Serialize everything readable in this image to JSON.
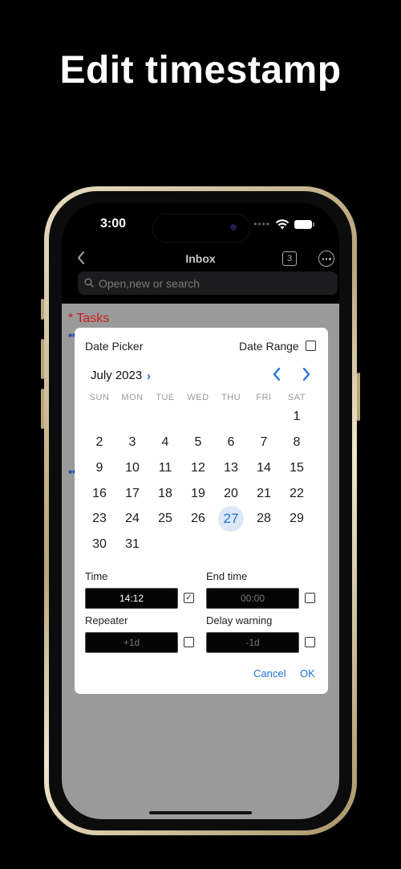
{
  "headline": "Edit timestamp",
  "status": {
    "time": "3:00"
  },
  "nav": {
    "title": "Inbox",
    "count": "3"
  },
  "search": {
    "placeholder": "Open,new or search"
  },
  "doc": {
    "heading": "* Tasks",
    "marker1": "**",
    "marker2": "**"
  },
  "dialog": {
    "title": "Date Picker",
    "range_label": "Date Range",
    "range_checked": false,
    "month_label": "July 2023",
    "weekdays": [
      "SUN",
      "MON",
      "TUE",
      "WED",
      "THU",
      "FRI",
      "SAT"
    ],
    "days": [
      "1",
      "2",
      "3",
      "4",
      "5",
      "6",
      "7",
      "8",
      "9",
      "10",
      "11",
      "12",
      "13",
      "14",
      "15",
      "16",
      "17",
      "18",
      "19",
      "20",
      "21",
      "22",
      "23",
      "24",
      "25",
      "26",
      "27",
      "28",
      "29",
      "30",
      "31"
    ],
    "selected_day": "27",
    "time_label": "Time",
    "time_value": "14:12",
    "time_checked": true,
    "end_time_label": "End time",
    "end_time_placeholder": "00:00",
    "end_time_checked": false,
    "repeater_label": "Repeater",
    "repeater_placeholder": "+1d",
    "repeater_checked": false,
    "delay_label": "Delay warning",
    "delay_placeholder": "-1d",
    "delay_checked": false,
    "cancel_label": "Cancel",
    "ok_label": "OK"
  },
  "colors": {
    "accent": "#1e6fd9",
    "heading_red": "#d11b1b",
    "marker_blue": "#1a3aa8",
    "selected_bg": "#dde8f6"
  }
}
